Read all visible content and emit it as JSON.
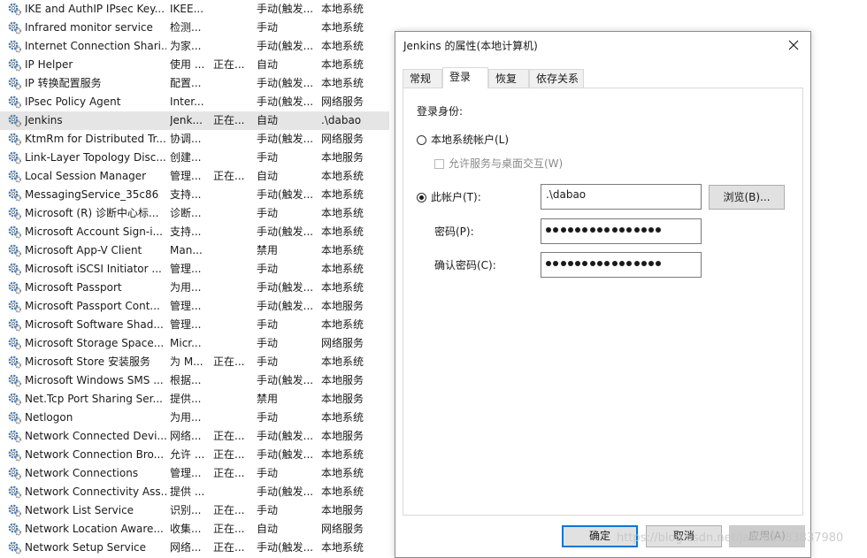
{
  "services": [
    {
      "name": "IKE and AuthIP IPsec Key...",
      "desc": "IKEE...",
      "status": "",
      "startup": "手动(触发...",
      "logon": "本地系统"
    },
    {
      "name": "Infrared monitor service",
      "desc": "检测...",
      "status": "",
      "startup": "手动",
      "logon": "本地系统"
    },
    {
      "name": "Internet Connection Shari...",
      "desc": "为家...",
      "status": "",
      "startup": "手动(触发...",
      "logon": "本地系统"
    },
    {
      "name": "IP Helper",
      "desc": "使用 ...",
      "status": "正在...",
      "startup": "自动",
      "logon": "本地系统"
    },
    {
      "name": "IP 转换配置服务",
      "desc": "配置...",
      "status": "",
      "startup": "手动(触发...",
      "logon": "本地系统"
    },
    {
      "name": "IPsec Policy Agent",
      "desc": "Inter...",
      "status": "",
      "startup": "手动(触发...",
      "logon": "网络服务"
    },
    {
      "name": "Jenkins",
      "desc": "Jenk...",
      "status": "正在...",
      "startup": "自动",
      "logon": ".\\dabao",
      "selected": true
    },
    {
      "name": "KtmRm for Distributed Tr...",
      "desc": "协调...",
      "status": "",
      "startup": "手动(触发...",
      "logon": "网络服务"
    },
    {
      "name": "Link-Layer Topology Disc...",
      "desc": "创建...",
      "status": "",
      "startup": "手动",
      "logon": "本地服务"
    },
    {
      "name": "Local Session Manager",
      "desc": "管理...",
      "status": "正在...",
      "startup": "自动",
      "logon": "本地系统"
    },
    {
      "name": "MessagingService_35c86",
      "desc": "支持...",
      "status": "",
      "startup": "手动(触发...",
      "logon": "本地系统"
    },
    {
      "name": "Microsoft (R) 诊断中心标...",
      "desc": "诊断...",
      "status": "",
      "startup": "手动",
      "logon": "本地系统"
    },
    {
      "name": "Microsoft Account Sign-i...",
      "desc": "支持...",
      "status": "",
      "startup": "手动(触发...",
      "logon": "本地系统"
    },
    {
      "name": "Microsoft App-V Client",
      "desc": "Man...",
      "status": "",
      "startup": "禁用",
      "logon": "本地系统"
    },
    {
      "name": "Microsoft iSCSI Initiator ...",
      "desc": "管理...",
      "status": "",
      "startup": "手动",
      "logon": "本地系统"
    },
    {
      "name": "Microsoft Passport",
      "desc": "为用...",
      "status": "",
      "startup": "手动(触发...",
      "logon": "本地系统"
    },
    {
      "name": "Microsoft Passport Cont...",
      "desc": "管理...",
      "status": "",
      "startup": "手动(触发...",
      "logon": "本地服务"
    },
    {
      "name": "Microsoft Software Shad...",
      "desc": "管理...",
      "status": "",
      "startup": "手动",
      "logon": "本地系统"
    },
    {
      "name": "Microsoft Storage Space...",
      "desc": "Micr...",
      "status": "",
      "startup": "手动",
      "logon": "网络服务"
    },
    {
      "name": "Microsoft Store 安装服务",
      "desc": "为 M...",
      "status": "正在...",
      "startup": "手动",
      "logon": "本地系统"
    },
    {
      "name": "Microsoft Windows SMS ...",
      "desc": "根据...",
      "status": "",
      "startup": "手动(触发...",
      "logon": "本地服务"
    },
    {
      "name": "Net.Tcp Port Sharing Ser...",
      "desc": "提供...",
      "status": "",
      "startup": "禁用",
      "logon": "本地服务"
    },
    {
      "name": "Netlogon",
      "desc": "为用...",
      "status": "",
      "startup": "手动",
      "logon": "本地系统"
    },
    {
      "name": "Network Connected Devi...",
      "desc": "网络...",
      "status": "正在...",
      "startup": "手动(触发...",
      "logon": "本地服务"
    },
    {
      "name": "Network Connection Bro...",
      "desc": "允许 ...",
      "status": "正在...",
      "startup": "手动(触发...",
      "logon": "本地系统"
    },
    {
      "name": "Network Connections",
      "desc": "管理...",
      "status": "正在...",
      "startup": "手动",
      "logon": "本地系统"
    },
    {
      "name": "Network Connectivity Ass...",
      "desc": "提供 ...",
      "status": "",
      "startup": "手动(触发...",
      "logon": "本地系统"
    },
    {
      "name": "Network List Service",
      "desc": "识别...",
      "status": "正在...",
      "startup": "手动",
      "logon": "本地服务"
    },
    {
      "name": "Network Location Aware...",
      "desc": "收集...",
      "status": "正在...",
      "startup": "自动",
      "logon": "网络服务"
    },
    {
      "name": "Network Setup Service",
      "desc": "网络...",
      "status": "正在...",
      "startup": "手动(触发...",
      "logon": "本地系统"
    }
  ],
  "dialog": {
    "title": "Jenkins 的属性(本地计算机)",
    "tabs": [
      "常规",
      "登录",
      "恢复",
      "依存关系"
    ],
    "active_tab": "登录",
    "logon_as_label": "登录身份:",
    "local_system_label": "本地系统帐户(L)",
    "interact_desktop_label": "允许服务与桌面交互(W)",
    "this_account_label": "此帐户(T):",
    "account_value": ".\\dabao",
    "browse_label": "浏览(B)...",
    "password_label": "密码(P):",
    "password_mask_count": 16,
    "confirm_label": "确认密码(C):",
    "confirm_mask_count": 16,
    "ok_label": "确定",
    "cancel_label": "取消",
    "apply_label": "应用(A)",
    "local_system_selected": false,
    "this_account_selected": true,
    "interact_desktop_checked": false
  },
  "watermark": "https://blog.csdn.net/jason1283837980",
  "colors": {
    "selected_row": "#e5e5e5",
    "accent_border": "#0078d7",
    "icon_gear": "#4a7fb5"
  }
}
